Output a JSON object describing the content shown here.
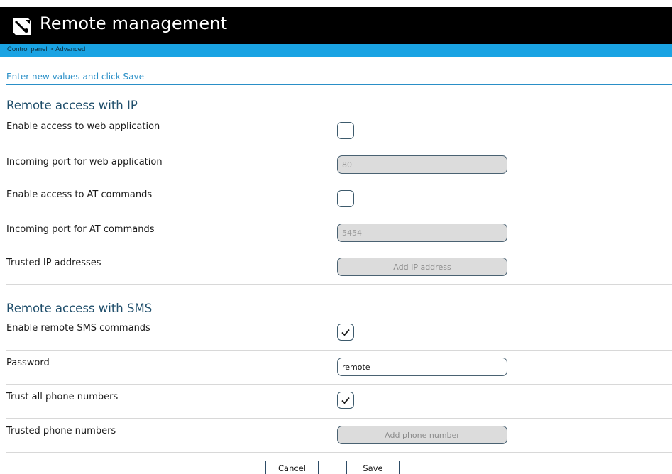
{
  "header": {
    "title": "Remote management",
    "logo_icon": "satellite-dish-icon"
  },
  "breadcrumb": {
    "items": [
      "Control panel",
      "Advanced"
    ],
    "separator": ">"
  },
  "instructions": "Enter new values and click Save",
  "sections": {
    "ip": {
      "title": "Remote access with IP",
      "rows": {
        "web_access": {
          "label": "Enable access to web application",
          "checked": false
        },
        "web_port": {
          "label": "Incoming port for web application",
          "value": "80"
        },
        "at_access": {
          "label": "Enable access to AT commands",
          "checked": false
        },
        "at_port": {
          "label": "Incoming port for AT commands",
          "value": "5454"
        },
        "trusted_ips": {
          "label": "Trusted IP addresses",
          "button": "Add IP address"
        }
      }
    },
    "sms": {
      "title": "Remote access with SMS",
      "rows": {
        "sms_commands": {
          "label": "Enable remote SMS commands",
          "checked": true
        },
        "password": {
          "label": "Password",
          "value": "remote"
        },
        "trust_all": {
          "label": "Trust all phone numbers",
          "checked": true
        },
        "trusted_numbers": {
          "label": "Trusted phone numbers",
          "button": "Add phone number"
        }
      }
    }
  },
  "footer": {
    "cancel_label": "Cancel",
    "save_label": "Save"
  },
  "colors": {
    "header_bg": "#000000",
    "crumb_bar": "#1aa3e3",
    "link_blue": "#2a8fc7",
    "section_title": "#1f4e6b"
  }
}
